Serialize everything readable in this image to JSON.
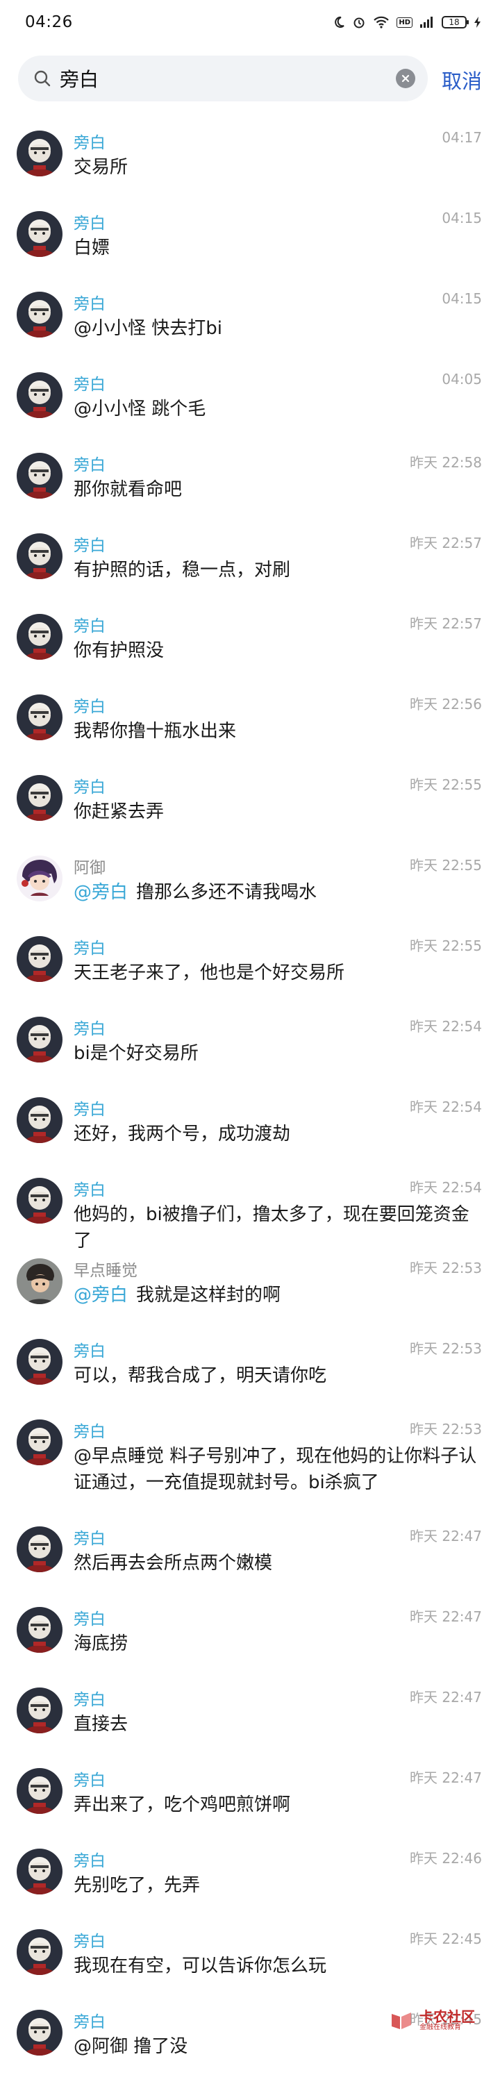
{
  "status_bar": {
    "time": "04:26",
    "battery": "18"
  },
  "search": {
    "query": "旁白",
    "cancel_label": "取消"
  },
  "results": [
    {
      "name": "旁白",
      "time": "04:17",
      "message": "交易所",
      "avatar": "a"
    },
    {
      "name": "旁白",
      "time": "04:15",
      "message": "白嫖",
      "avatar": "a"
    },
    {
      "name": "旁白",
      "time": "04:15",
      "message": "@小小怪 快去打bi",
      "avatar": "a"
    },
    {
      "name": "旁白",
      "time": "04:05",
      "message": "@小小怪 跳个毛",
      "avatar": "a"
    },
    {
      "name": "旁白",
      "time": "昨天 22:58",
      "message": "那你就看命吧",
      "avatar": "a"
    },
    {
      "name": "旁白",
      "time": "昨天 22:57",
      "message": "有护照的话，稳一点，对刷",
      "avatar": "a"
    },
    {
      "name": "旁白",
      "time": "昨天 22:57",
      "message": "你有护照没",
      "avatar": "a"
    },
    {
      "name": "旁白",
      "time": "昨天 22:56",
      "message": "我帮你撸十瓶水出来",
      "avatar": "a"
    },
    {
      "name": "旁白",
      "time": "昨天 22:55",
      "message": "你赶紧去弄",
      "avatar": "a"
    },
    {
      "name": "阿御",
      "time": "昨天 22:55",
      "mention": "@旁白",
      "message": "撸那么多还不请我喝水",
      "avatar": "b"
    },
    {
      "name": "旁白",
      "time": "昨天 22:55",
      "message": "天王老子来了，他也是个好交易所",
      "avatar": "a"
    },
    {
      "name": "旁白",
      "time": "昨天 22:54",
      "message": "bi是个好交易所",
      "avatar": "a"
    },
    {
      "name": "旁白",
      "time": "昨天 22:54",
      "message": "还好，我两个号，成功渡劫",
      "avatar": "a"
    },
    {
      "name": "旁白",
      "time": "昨天 22:54",
      "message": "他妈的，bi被撸子们，撸太多了，现在要回笼资金了",
      "avatar": "a"
    },
    {
      "name": "早点睡觉",
      "time": "昨天 22:53",
      "mention": "@旁白",
      "message": "我就是这样封的啊",
      "avatar": "c"
    },
    {
      "name": "旁白",
      "time": "昨天 22:53",
      "message": "可以，帮我合成了，明天请你吃",
      "avatar": "a"
    },
    {
      "name": "旁白",
      "time": "昨天 22:53",
      "message": "@早点睡觉 料子号别冲了，现在他妈的让你料子认证通过，一充值提现就封号。bi杀疯了",
      "avatar": "a",
      "tall": true
    },
    {
      "name": "旁白",
      "time": "昨天 22:47",
      "message": "然后再去会所点两个嫩模",
      "avatar": "a"
    },
    {
      "name": "旁白",
      "time": "昨天 22:47",
      "message": "海底捞",
      "avatar": "a"
    },
    {
      "name": "旁白",
      "time": "昨天 22:47",
      "message": "直接去",
      "avatar": "a"
    },
    {
      "name": "旁白",
      "time": "昨天 22:47",
      "message": "弄出来了，吃个鸡吧煎饼啊",
      "avatar": "a"
    },
    {
      "name": "旁白",
      "time": "昨天 22:46",
      "message": "先别吃了，先弄",
      "avatar": "a"
    },
    {
      "name": "旁白",
      "time": "昨天 22:45",
      "message": "我现在有空，可以告诉你怎么玩",
      "avatar": "a"
    },
    {
      "name": "旁白",
      "time": "昨天 22:45",
      "message": "@阿御 撸了没",
      "avatar": "a"
    }
  ],
  "watermark": {
    "main": "卡农社区",
    "sub": "金融在线教育"
  },
  "colors": {
    "accent": "#38a7d6",
    "cancel": "#2a5dc8",
    "timestamp": "#a8a8a8"
  }
}
